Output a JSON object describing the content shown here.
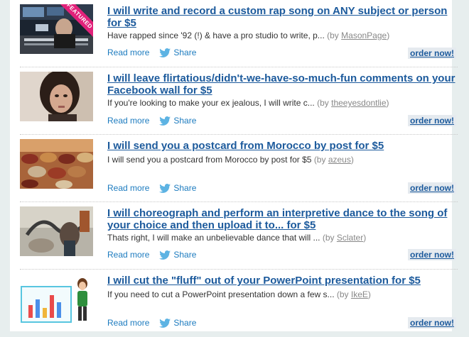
{
  "gigs": [
    {
      "title": "I will write and record a custom rap song on ANY subject or person for $5",
      "description": "Have rapped since '92 (!) & have a pro studio to write, p...",
      "by_prefix": "(by ",
      "author": "MasonPage",
      "by_suffix": ")",
      "badge": "FEATURED",
      "thumb_icon": "studio-musician-photo"
    },
    {
      "title": "I will leave flirtatious/didn't-we-have-so-much-fun comments on your Facebook wall for $5",
      "description": "If you're looking to make your ex jealous, I will write c...",
      "by_prefix": "(by ",
      "author": "theeyesdontlie",
      "by_suffix": ")",
      "thumb_icon": "woman-portrait-photo"
    },
    {
      "title": "I will send you a postcard from Morocco by post for $5",
      "description": "I will send you a postcard from Morocco by post for $5",
      "by_prefix": "(by ",
      "author": "azeus",
      "by_suffix": ")",
      "thumb_icon": "morocco-tannery-photo"
    },
    {
      "title": "I will choreograph and perform an interpretive dance to the song of your choice and then upload it to... for $5",
      "description": "Thats right, I will make an unbelievable dance that will ...",
      "by_prefix": "(by ",
      "author": "Sclater",
      "by_suffix": ")",
      "thumb_icon": "dance-photo"
    },
    {
      "title": "I will cut the \"fluff\" out of your PowerPoint presentation for $5",
      "description": "If you need to cut a PowerPoint presentation down a few s...",
      "by_prefix": "(by ",
      "author": "IkeE",
      "by_suffix": ")",
      "thumb_icon": "presentation-illustration"
    }
  ],
  "labels": {
    "read_more": "Read more",
    "share": "Share",
    "order_now": "order now!"
  },
  "colors": {
    "link_blue": "#1c5a9c",
    "share_blue": "#1c7bbf",
    "featured_pink": "#e2217a",
    "page_bg": "#e7eeee"
  }
}
